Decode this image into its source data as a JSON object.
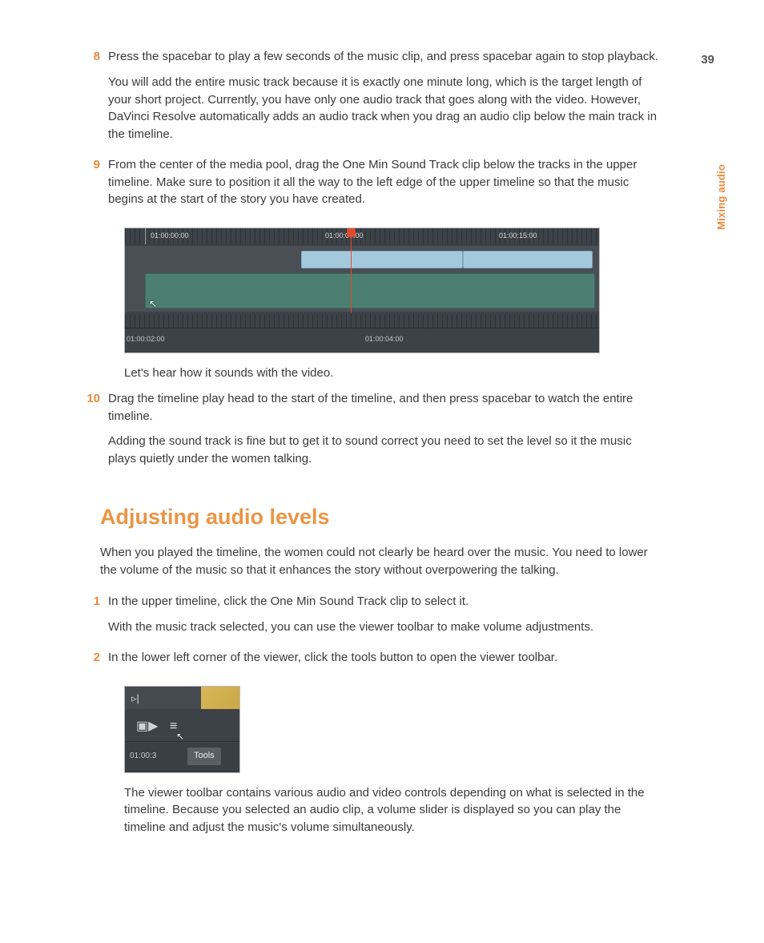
{
  "page_number": "39",
  "side_label": "Mixing audio",
  "steps_a": [
    {
      "n": "8",
      "paras": [
        "Press the spacebar to play a few seconds of the music clip, and press spacebar again to stop playback.",
        "You will add the entire music track because it is exactly one minute long, which is the target length of your short project. Currently, you have only one audio track that goes along with the video. However, DaVinci Resolve automatically adds an audio track when you drag an audio clip below the main track in the timeline."
      ]
    },
    {
      "n": "9",
      "paras": [
        "From the center of the media pool, drag the One Min Sound Track clip below the tracks in the upper timeline. Make sure to position it all the way to the left edge of the upper timeline so that the music begins at the start of the story you have created."
      ]
    }
  ],
  "timeline": {
    "tc_a": "01:00:00:00",
    "tc_b": "01:00:07:00",
    "tc_c": "01:00:15:00",
    "tc_d": "01:00:02:00",
    "tc_e": "01:00:04:00"
  },
  "after_timeline": "Let's hear how it sounds with the video.",
  "steps_b": [
    {
      "n": "10",
      "paras": [
        "Drag the timeline play head to the start of the timeline, and then press spacebar to watch the entire timeline.",
        "Adding the sound track is fine but to get it to sound correct you need to set the level so it the music plays quietly under the women talking."
      ]
    }
  ],
  "section_title": "Adjusting audio levels",
  "section_lead": "When you played the timeline, the women could not clearly be heard over the music. You need to lower the volume of the music so that it enhances the story without overpowering the talking.",
  "steps_c": [
    {
      "n": "1",
      "paras": [
        "In the upper timeline, click the One Min Sound Track clip to select it.",
        "With the music track selected, you can use the viewer toolbar to make volume adjustments."
      ]
    },
    {
      "n": "2",
      "paras": [
        "In the lower left corner of the viewer, click the tools button to open the viewer toolbar."
      ]
    }
  ],
  "tools_fig": {
    "tc": "01:00:3",
    "tooltip": "Tools"
  },
  "after_tools": "The viewer toolbar contains various audio and video controls depending on what is selected in the timeline. Because you selected an audio clip, a volume slider is displayed so you can play the timeline and adjust the music's volume simultaneously."
}
